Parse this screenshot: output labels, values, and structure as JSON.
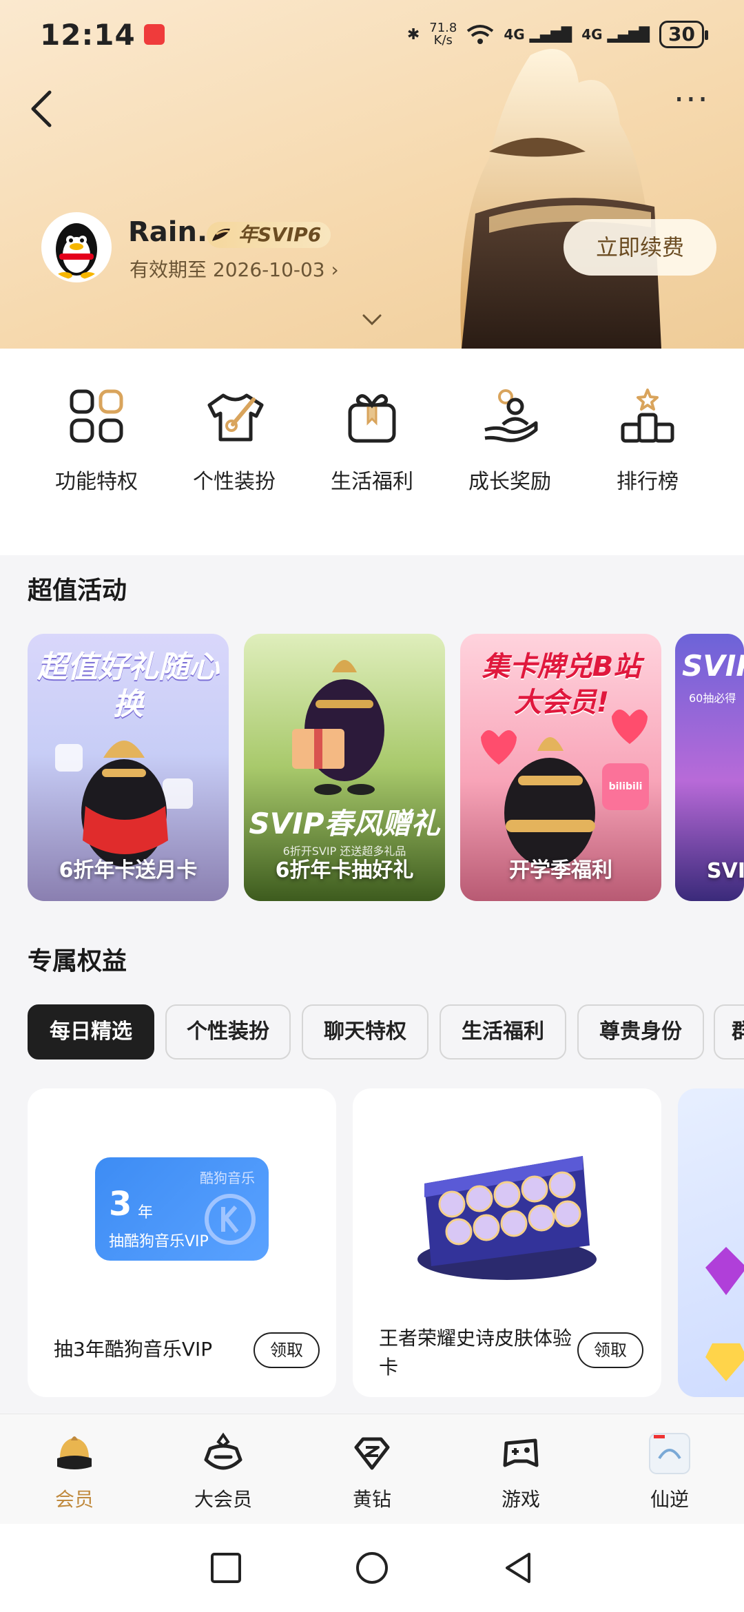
{
  "status_bar": {
    "time": "12:14",
    "net_speed_value": "71.8",
    "net_speed_unit": "K/s",
    "signal_1": "4G",
    "signal_2": "4G",
    "battery": "30"
  },
  "header": {
    "username": "Rain.",
    "vip_badge": "年SVIP6",
    "expire_text": "有效期至 2026-10-03 ›",
    "renew_label": "立即续费"
  },
  "shortcuts": [
    {
      "label": "功能特权",
      "icon": "grid-icon"
    },
    {
      "label": "个性装扮",
      "icon": "shirt-brush-icon"
    },
    {
      "label": "生活福利",
      "icon": "gift-icon"
    },
    {
      "label": "成长奖励",
      "icon": "hand-person-icon"
    },
    {
      "label": "排行榜",
      "icon": "podium-icon"
    }
  ],
  "activities_section": {
    "title": "超值活动",
    "cards": [
      {
        "headline": "超值好礼随心换",
        "label": "6折年卡送月卡"
      },
      {
        "headline": "SVIP春风赠礼",
        "sub": "6折开SVIP 还送超多礼品",
        "label": "6折年卡抽好礼"
      },
      {
        "headline": "集卡牌兑B站大会员!",
        "badge": "bilibili",
        "label": "开学季福利"
      },
      {
        "headline": "SVIP",
        "sub": "60抽必得",
        "label": "SVIP"
      }
    ]
  },
  "benefits_section": {
    "title": "专属权益",
    "tabs": [
      "每日精选",
      "个性装扮",
      "聊天特权",
      "生活福利",
      "尊贵身份",
      "群"
    ],
    "active_tab": "每日精选",
    "cards": [
      {
        "name": "抽3年酷狗音乐VIP",
        "claim": "领取",
        "art_years": "3",
        "art_year_unit": "年",
        "art_brand": "酷狗音乐",
        "art_text": "抽酷狗音乐VIP"
      },
      {
        "name": "王者荣耀史诗皮肤体验卡",
        "claim": "领取"
      }
    ]
  },
  "bottom_nav": [
    {
      "label": "会员",
      "icon": "crown-icon",
      "active": true
    },
    {
      "label": "大会员",
      "icon": "penguin-face-icon",
      "active": false
    },
    {
      "label": "黄钻",
      "icon": "yellow-diamond-icon",
      "active": false
    },
    {
      "label": "游戏",
      "icon": "gamepad-icon",
      "active": false
    },
    {
      "label": "仙逆",
      "icon": "xianni-app-icon",
      "active": false
    }
  ],
  "colors": {
    "accent_gold": "#c08a3e",
    "hero_bg": "#f6d9ae",
    "active_tab": "#1f1f1f"
  }
}
